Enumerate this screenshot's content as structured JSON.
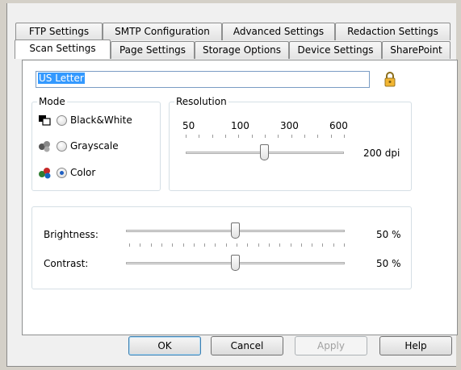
{
  "tabs_row1": [
    "FTP Settings",
    "SMTP Configuration",
    "Advanced Settings",
    "Redaction Settings"
  ],
  "tabs_row2": [
    "Scan Settings",
    "Page Settings",
    "Storage Options",
    "Device Settings",
    "SharePoint"
  ],
  "active_tab": "Scan Settings",
  "preset": {
    "value": "US Letter",
    "locked": true
  },
  "mode": {
    "title": "Mode",
    "options": [
      {
        "label": "Black&White",
        "icon": "black-white-icon",
        "checked": false
      },
      {
        "label": "Grayscale",
        "icon": "grayscale-icon",
        "checked": false
      },
      {
        "label": "Color",
        "icon": "color-icon",
        "checked": true
      }
    ]
  },
  "resolution": {
    "title": "Resolution",
    "scale_labels": [
      "50",
      "100",
      "300",
      "600"
    ],
    "value_label": "200 dpi",
    "slider_fraction": 0.5
  },
  "adjustments": {
    "brightness": {
      "label": "Brightness:",
      "value_label": "50 %",
      "fraction": 0.5
    },
    "contrast": {
      "label": "Contrast:",
      "value_label": "50 %",
      "fraction": 0.5
    }
  },
  "buttons": {
    "ok": "OK",
    "cancel": "Cancel",
    "apply": "Apply",
    "help": "Help"
  },
  "colors": {
    "selection": "#3399ff",
    "radio_dot": "#1f5fc2",
    "lock": "#e8a317"
  }
}
